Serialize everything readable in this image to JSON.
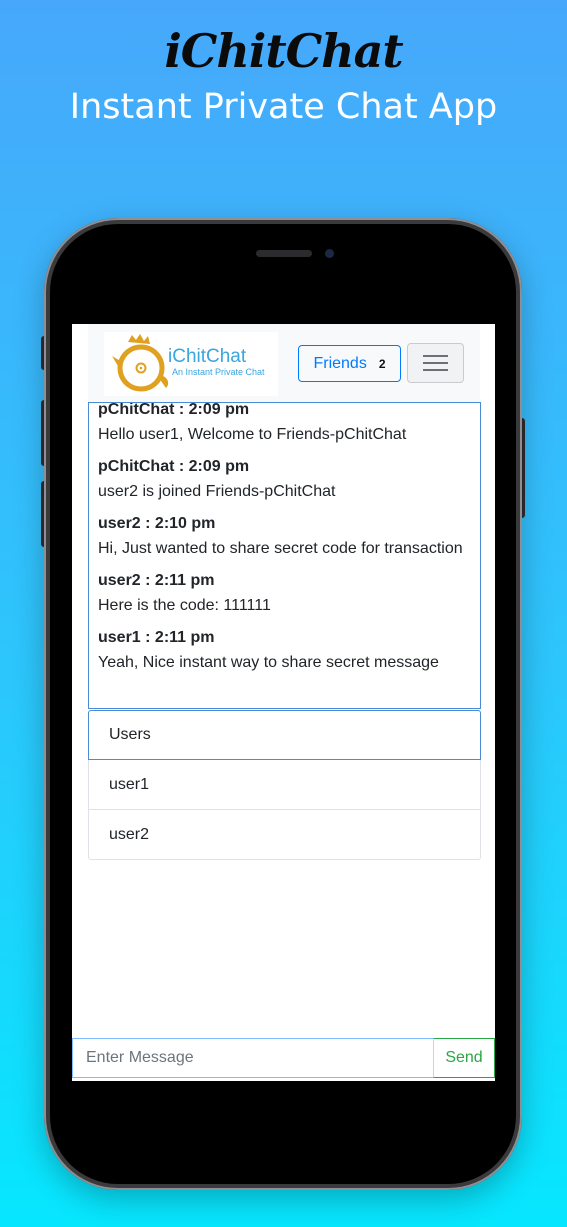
{
  "promo": {
    "title": "iChitChat",
    "subtitle": "Instant Private Chat App"
  },
  "navbar": {
    "brand_name": "iChitChat",
    "brand_tagline": "An Instant Private Chat",
    "friends_label": "Friends",
    "friends_count": "2",
    "menu_icon": "hamburger-icon",
    "logo_icon": "chick-logo-icon"
  },
  "messages": [
    {
      "sender": "pChitChat : 2:09 pm",
      "text": "Hello user1, Welcome to Friends-pChitChat"
    },
    {
      "sender": "pChitChat : 2:09 pm",
      "text": "user2 is joined Friends-pChitChat"
    },
    {
      "sender": "user2 : 2:10 pm",
      "text": "Hi, Just wanted to share secret code for transaction"
    },
    {
      "sender": "user2 : 2:11 pm",
      "text": "Here is the code: 111111"
    },
    {
      "sender": "user1 : 2:11 pm",
      "text": "Yeah, Nice instant way to share secret message"
    }
  ],
  "users": {
    "header": "Users",
    "items": [
      "user1",
      "user2"
    ]
  },
  "composer": {
    "placeholder": "Enter Message",
    "value": "",
    "send_label": "Send"
  },
  "colors": {
    "primary": "#007bff",
    "success": "#28a745",
    "brand": "#3aa5de",
    "logo": "#e0a020"
  }
}
